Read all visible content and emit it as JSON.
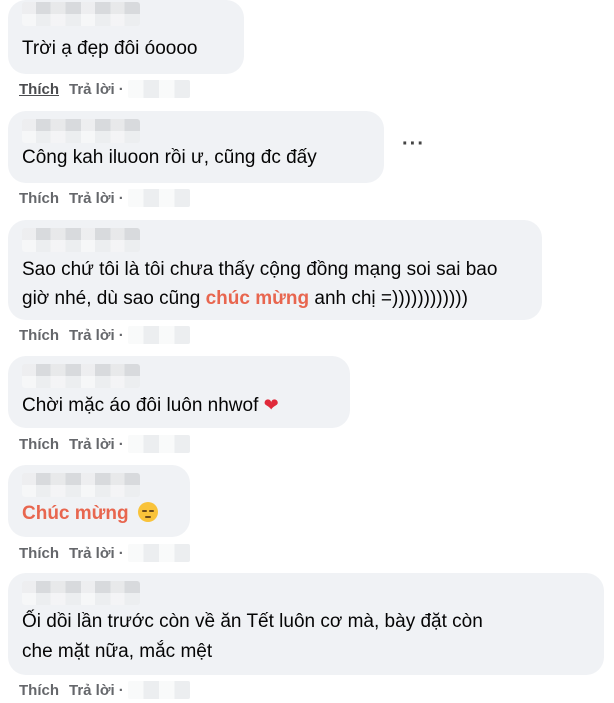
{
  "actions": {
    "like": "Thích",
    "reply": "Trả lời",
    "sep": "·"
  },
  "comments": [
    {
      "text": "Trời ạ đẹp đôi óoooo"
    },
    {
      "text": "Công kah iluoon rồi ư, cũng đc đấy"
    },
    {
      "line1": "Sao chứ tôi là tôi chưa thấy cộng đồng mạng soi sai bao",
      "line2_pre": "giờ nhé, dù sao cũng ",
      "line2_hl": "chúc mừng",
      "line2_post": " anh chị =))))))))))))"
    },
    {
      "text": "Chời mặc áo đôi luôn nhwof",
      "emoji": "❤"
    },
    {
      "hl": "Chúc mừng",
      "emoji": "pensive-face-emoji"
    },
    {
      "line1": "Ối dồi lần trước còn về ăn Tết luôn cơ mà, bày đặt còn",
      "line2": "che mặt nữa, mắc mệt"
    }
  ],
  "more_label": "···"
}
